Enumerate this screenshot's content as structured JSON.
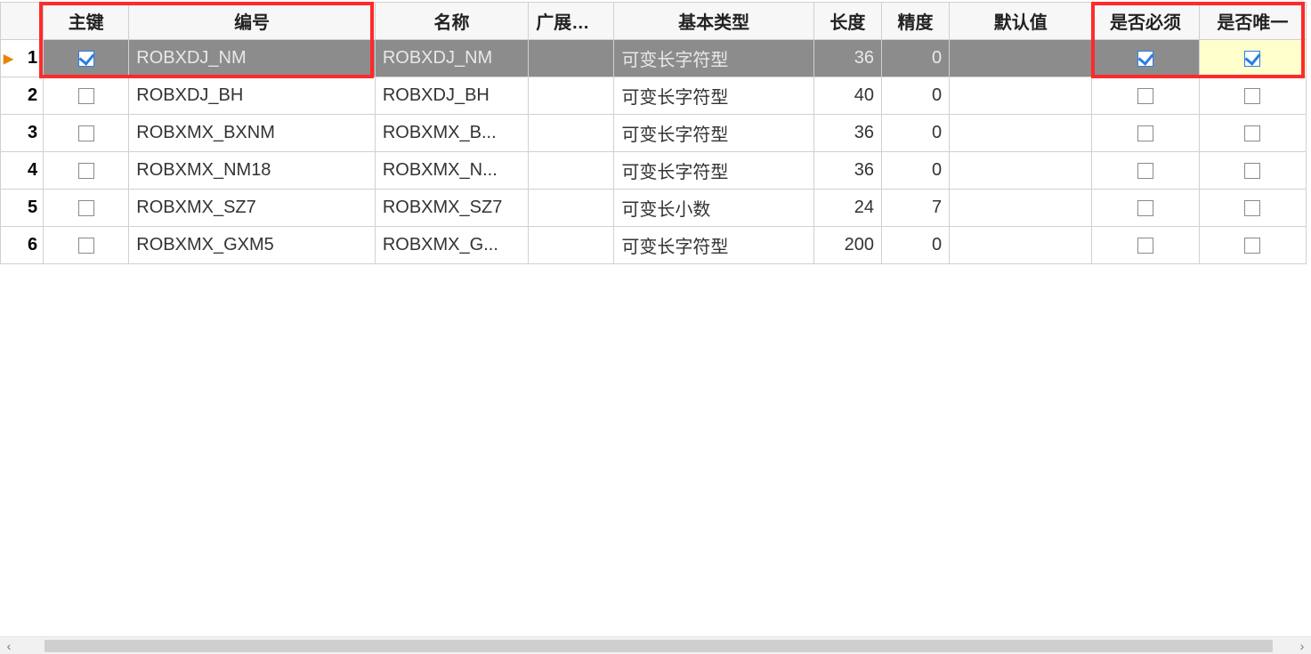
{
  "columns": {
    "pk": "主键",
    "code": "编号",
    "name": "名称",
    "ext": "广展类型",
    "base": "基本类型",
    "len": "长度",
    "prec": "精度",
    "def": "默认值",
    "req": "是否必须",
    "uniq": "是否唯一"
  },
  "rows": [
    {
      "idx": "1",
      "pk": true,
      "code": "ROBXDJ_NM",
      "name": "ROBXDJ_NM",
      "ext": "",
      "base": "可变长字符型",
      "len": "36",
      "prec": "0",
      "def": "",
      "req": true,
      "uniq": true,
      "selected": true,
      "marker": true
    },
    {
      "idx": "2",
      "pk": false,
      "code": "ROBXDJ_BH",
      "name": "ROBXDJ_BH",
      "ext": "",
      "base": "可变长字符型",
      "len": "40",
      "prec": "0",
      "def": "",
      "req": false,
      "uniq": false,
      "selected": false,
      "marker": false
    },
    {
      "idx": "3",
      "pk": false,
      "code": "ROBXMX_BXNM",
      "name": "ROBXMX_B...",
      "ext": "",
      "base": "可变长字符型",
      "len": "36",
      "prec": "0",
      "def": "",
      "req": false,
      "uniq": false,
      "selected": false,
      "marker": false
    },
    {
      "idx": "4",
      "pk": false,
      "code": "ROBXMX_NM18",
      "name": "ROBXMX_N...",
      "ext": "",
      "base": "可变长字符型",
      "len": "36",
      "prec": "0",
      "def": "",
      "req": false,
      "uniq": false,
      "selected": false,
      "marker": false
    },
    {
      "idx": "5",
      "pk": false,
      "code": "ROBXMX_SZ7",
      "name": "ROBXMX_SZ7",
      "ext": "",
      "base": "可变长小数",
      "len": "24",
      "prec": "7",
      "def": "",
      "req": false,
      "uniq": false,
      "selected": false,
      "marker": false
    },
    {
      "idx": "6",
      "pk": false,
      "code": "ROBXMX_GXM5",
      "name": "ROBXMX_G...",
      "ext": "",
      "base": "可变长字符型",
      "len": "200",
      "prec": "0",
      "def": "",
      "req": false,
      "uniq": false,
      "selected": false,
      "marker": false
    }
  ],
  "scroll": {
    "left_arrow": "‹",
    "right_arrow": "›"
  }
}
